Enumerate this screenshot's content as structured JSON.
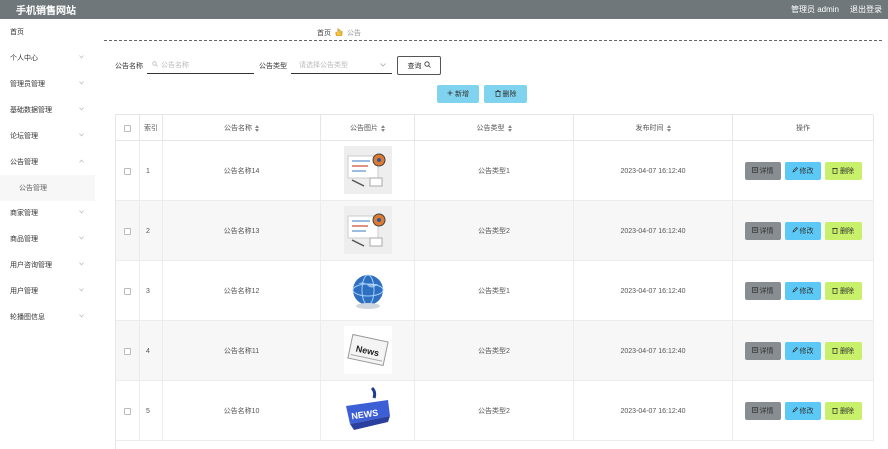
{
  "app": {
    "site_title": "手机销售网站",
    "user_label": "管理员 admin",
    "logout_label": "退出登录"
  },
  "sidebar": {
    "items": [
      {
        "label": "首页",
        "chevron": false
      },
      {
        "label": "个人中心",
        "chevron": true
      },
      {
        "label": "管理员管理",
        "chevron": true
      },
      {
        "label": "基础数据管理",
        "chevron": true
      },
      {
        "label": "论坛管理",
        "chevron": true
      },
      {
        "label": "公告管理",
        "chevron": true,
        "expanded": true
      },
      {
        "label": "公告管理",
        "sub": true
      },
      {
        "label": "商家管理",
        "chevron": true
      },
      {
        "label": "商品管理",
        "chevron": true
      },
      {
        "label": "用户咨询管理",
        "chevron": true
      },
      {
        "label": "用户管理",
        "chevron": true
      },
      {
        "label": "轮播图信息",
        "chevron": true
      }
    ]
  },
  "breadcrumb": {
    "home": "首页",
    "current": "公告"
  },
  "search": {
    "name_label": "公告名称",
    "name_placeholder": "公告名称",
    "type_label": "公告类型",
    "type_placeholder": "请选择公告类型",
    "query_label": "查询"
  },
  "toolbar": {
    "add_label": "新增",
    "delete_label": "删除"
  },
  "table": {
    "headers": {
      "index": "索引",
      "name": "公告名称",
      "image": "公告图片",
      "type": "公告类型",
      "time": "发布时间",
      "actions": "操作"
    },
    "action_labels": {
      "detail": "详情",
      "edit": "修改",
      "delete": "删除"
    },
    "rows": [
      {
        "index": "1",
        "name": "公告名称14",
        "image": "speech-bubble-icon",
        "type": "公告类型1",
        "time": "2023-04-07 16:12:40"
      },
      {
        "index": "2",
        "name": "公告名称13",
        "image": "speech-bubble-icon",
        "type": "公告类型2",
        "time": "2023-04-07 16:12:40"
      },
      {
        "index": "3",
        "name": "公告名称12",
        "image": "globe-icon",
        "type": "公告类型1",
        "time": "2023-04-07 16:12:40"
      },
      {
        "index": "4",
        "name": "公告名称11",
        "image": "newspaper-icon",
        "type": "公告类型2",
        "time": "2023-04-07 16:12:40"
      },
      {
        "index": "5",
        "name": "公告名称10",
        "image": "news-sign-icon",
        "type": "公告类型2",
        "time": "2023-04-07 16:12:40"
      }
    ]
  },
  "colors": {
    "header_bg": "#6f777b",
    "primary_btn": "#7fd3ef",
    "detail_btn": "#888d91",
    "edit_btn": "#5bc8f5",
    "delete_btn": "#c8f06a"
  }
}
